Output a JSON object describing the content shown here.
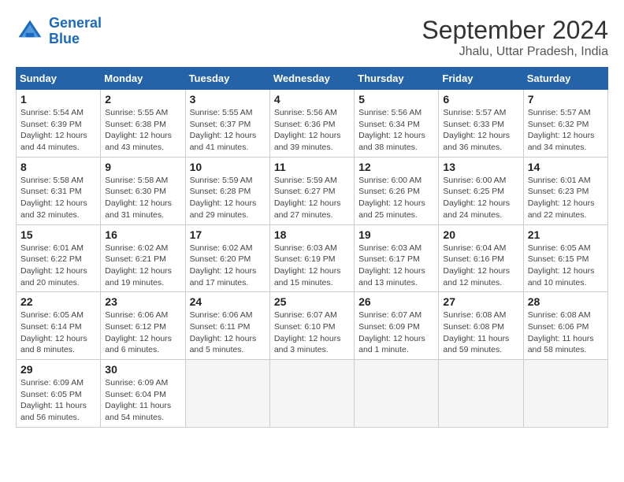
{
  "logo": {
    "line1": "General",
    "line2": "Blue"
  },
  "title": "September 2024",
  "subtitle": "Jhalu, Uttar Pradesh, India",
  "days_of_week": [
    "Sunday",
    "Monday",
    "Tuesday",
    "Wednesday",
    "Thursday",
    "Friday",
    "Saturday"
  ],
  "weeks": [
    [
      {
        "day": "1",
        "info": "Sunrise: 5:54 AM\nSunset: 6:39 PM\nDaylight: 12 hours\nand 44 minutes."
      },
      {
        "day": "2",
        "info": "Sunrise: 5:55 AM\nSunset: 6:38 PM\nDaylight: 12 hours\nand 43 minutes."
      },
      {
        "day": "3",
        "info": "Sunrise: 5:55 AM\nSunset: 6:37 PM\nDaylight: 12 hours\nand 41 minutes."
      },
      {
        "day": "4",
        "info": "Sunrise: 5:56 AM\nSunset: 6:36 PM\nDaylight: 12 hours\nand 39 minutes."
      },
      {
        "day": "5",
        "info": "Sunrise: 5:56 AM\nSunset: 6:34 PM\nDaylight: 12 hours\nand 38 minutes."
      },
      {
        "day": "6",
        "info": "Sunrise: 5:57 AM\nSunset: 6:33 PM\nDaylight: 12 hours\nand 36 minutes."
      },
      {
        "day": "7",
        "info": "Sunrise: 5:57 AM\nSunset: 6:32 PM\nDaylight: 12 hours\nand 34 minutes."
      }
    ],
    [
      {
        "day": "8",
        "info": "Sunrise: 5:58 AM\nSunset: 6:31 PM\nDaylight: 12 hours\nand 32 minutes."
      },
      {
        "day": "9",
        "info": "Sunrise: 5:58 AM\nSunset: 6:30 PM\nDaylight: 12 hours\nand 31 minutes."
      },
      {
        "day": "10",
        "info": "Sunrise: 5:59 AM\nSunset: 6:28 PM\nDaylight: 12 hours\nand 29 minutes."
      },
      {
        "day": "11",
        "info": "Sunrise: 5:59 AM\nSunset: 6:27 PM\nDaylight: 12 hours\nand 27 minutes."
      },
      {
        "day": "12",
        "info": "Sunrise: 6:00 AM\nSunset: 6:26 PM\nDaylight: 12 hours\nand 25 minutes."
      },
      {
        "day": "13",
        "info": "Sunrise: 6:00 AM\nSunset: 6:25 PM\nDaylight: 12 hours\nand 24 minutes."
      },
      {
        "day": "14",
        "info": "Sunrise: 6:01 AM\nSunset: 6:23 PM\nDaylight: 12 hours\nand 22 minutes."
      }
    ],
    [
      {
        "day": "15",
        "info": "Sunrise: 6:01 AM\nSunset: 6:22 PM\nDaylight: 12 hours\nand 20 minutes."
      },
      {
        "day": "16",
        "info": "Sunrise: 6:02 AM\nSunset: 6:21 PM\nDaylight: 12 hours\nand 19 minutes."
      },
      {
        "day": "17",
        "info": "Sunrise: 6:02 AM\nSunset: 6:20 PM\nDaylight: 12 hours\nand 17 minutes."
      },
      {
        "day": "18",
        "info": "Sunrise: 6:03 AM\nSunset: 6:19 PM\nDaylight: 12 hours\nand 15 minutes."
      },
      {
        "day": "19",
        "info": "Sunrise: 6:03 AM\nSunset: 6:17 PM\nDaylight: 12 hours\nand 13 minutes."
      },
      {
        "day": "20",
        "info": "Sunrise: 6:04 AM\nSunset: 6:16 PM\nDaylight: 12 hours\nand 12 minutes."
      },
      {
        "day": "21",
        "info": "Sunrise: 6:05 AM\nSunset: 6:15 PM\nDaylight: 12 hours\nand 10 minutes."
      }
    ],
    [
      {
        "day": "22",
        "info": "Sunrise: 6:05 AM\nSunset: 6:14 PM\nDaylight: 12 hours\nand 8 minutes."
      },
      {
        "day": "23",
        "info": "Sunrise: 6:06 AM\nSunset: 6:12 PM\nDaylight: 12 hours\nand 6 minutes."
      },
      {
        "day": "24",
        "info": "Sunrise: 6:06 AM\nSunset: 6:11 PM\nDaylight: 12 hours\nand 5 minutes."
      },
      {
        "day": "25",
        "info": "Sunrise: 6:07 AM\nSunset: 6:10 PM\nDaylight: 12 hours\nand 3 minutes."
      },
      {
        "day": "26",
        "info": "Sunrise: 6:07 AM\nSunset: 6:09 PM\nDaylight: 12 hours\nand 1 minute."
      },
      {
        "day": "27",
        "info": "Sunrise: 6:08 AM\nSunset: 6:08 PM\nDaylight: 11 hours\nand 59 minutes."
      },
      {
        "day": "28",
        "info": "Sunrise: 6:08 AM\nSunset: 6:06 PM\nDaylight: 11 hours\nand 58 minutes."
      }
    ],
    [
      {
        "day": "29",
        "info": "Sunrise: 6:09 AM\nSunset: 6:05 PM\nDaylight: 11 hours\nand 56 minutes."
      },
      {
        "day": "30",
        "info": "Sunrise: 6:09 AM\nSunset: 6:04 PM\nDaylight: 11 hours\nand 54 minutes."
      },
      {
        "day": "",
        "info": ""
      },
      {
        "day": "",
        "info": ""
      },
      {
        "day": "",
        "info": ""
      },
      {
        "day": "",
        "info": ""
      },
      {
        "day": "",
        "info": ""
      }
    ]
  ]
}
